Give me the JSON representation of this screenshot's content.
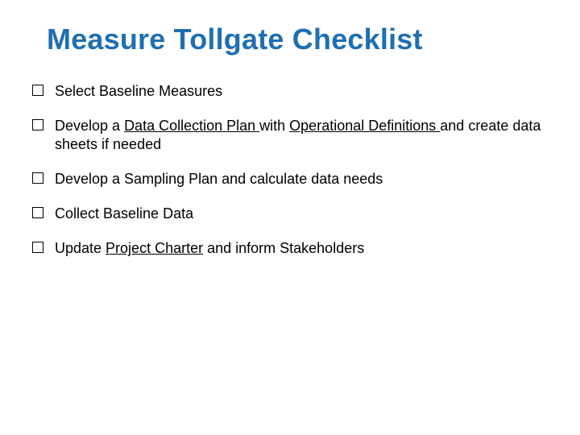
{
  "title": "Measure Tollgate Checklist",
  "items": [
    {
      "segments": [
        {
          "text": "Select Baseline Measures",
          "link": false
        }
      ]
    },
    {
      "segments": [
        {
          "text": "Develop a ",
          "link": false
        },
        {
          "text": "Data Collection Plan ",
          "link": true
        },
        {
          "text": "with ",
          "link": false
        },
        {
          "text": "Operational Definitions ",
          "link": true
        },
        {
          "text": "and create data sheets if needed",
          "link": false
        }
      ]
    },
    {
      "segments": [
        {
          "text": "Develop a Sampling Plan and calculate data needs",
          "link": false
        }
      ]
    },
    {
      "segments": [
        {
          "text": "Collect Baseline Data",
          "link": false
        }
      ]
    },
    {
      "segments": [
        {
          "text": "Update ",
          "link": false
        },
        {
          "text": "Project Charter",
          "link": true
        },
        {
          "text": " and inform Stakeholders",
          "link": false
        }
      ]
    }
  ]
}
